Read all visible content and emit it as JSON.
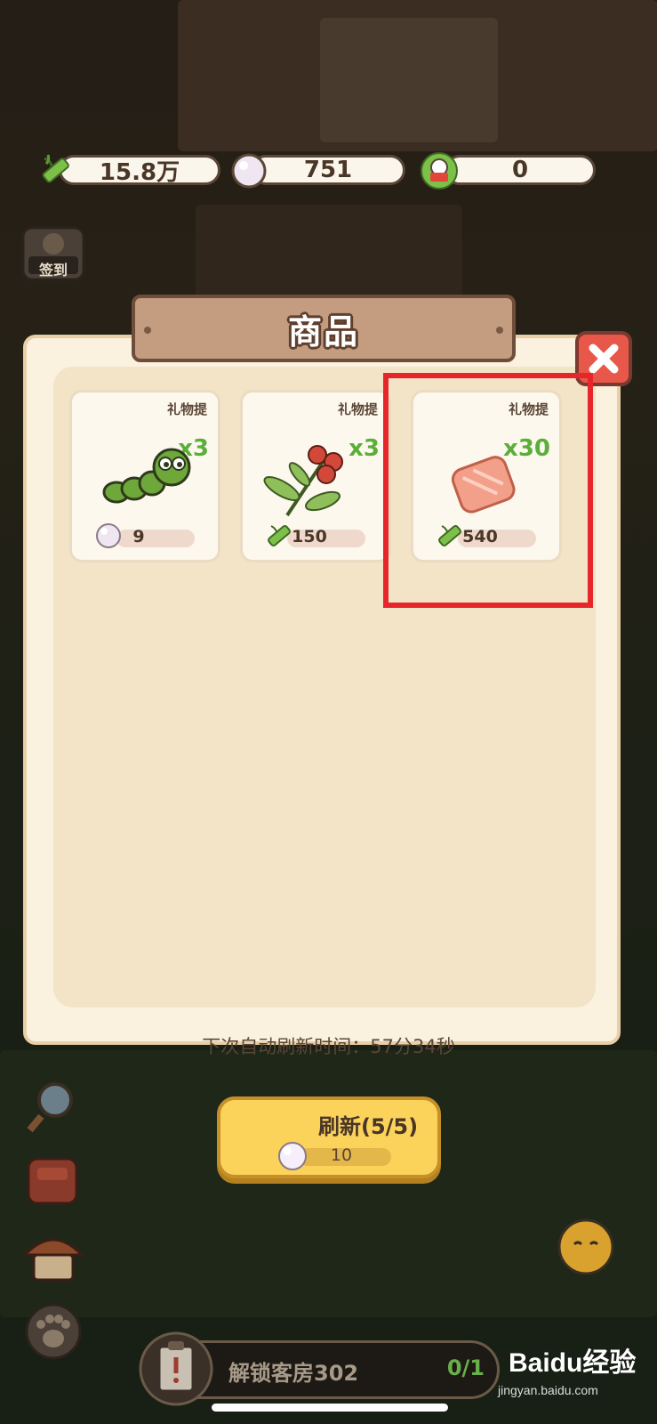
{
  "currency": {
    "bamboo": "15.8万",
    "pearls": "751",
    "tickets": "0"
  },
  "side": {
    "checkin_label": "签到"
  },
  "shop": {
    "title": "商品",
    "refresh_note": "下次自动刷新时间：57分34秒",
    "items": [
      {
        "tag": "礼物提",
        "qty": "x3",
        "price": "9",
        "currency": "pearl",
        "item_icon": "caterpillar-icon"
      },
      {
        "tag": "礼物提",
        "qty": "x3",
        "price": "150",
        "currency": "bamboo",
        "item_icon": "berry-plant-icon"
      },
      {
        "tag": "礼物提",
        "qty": "x30",
        "price": "540",
        "currency": "bamboo",
        "item_icon": "salt-block-icon"
      }
    ],
    "refresh_button": {
      "label": "刷新(5/5)",
      "cost": "10"
    }
  },
  "task": {
    "label": "解锁客房302",
    "count": "0/1"
  },
  "watermark": {
    "logo": "Baidu经验",
    "url": "jingyan.baidu.com"
  },
  "colors": {
    "panel": "#fbf1df",
    "title_plank": "#c49d80",
    "close": "#e8584a",
    "qty_green": "#5cae3a",
    "refresh_button": "#fbd35b",
    "highlight": "#e6262a"
  }
}
